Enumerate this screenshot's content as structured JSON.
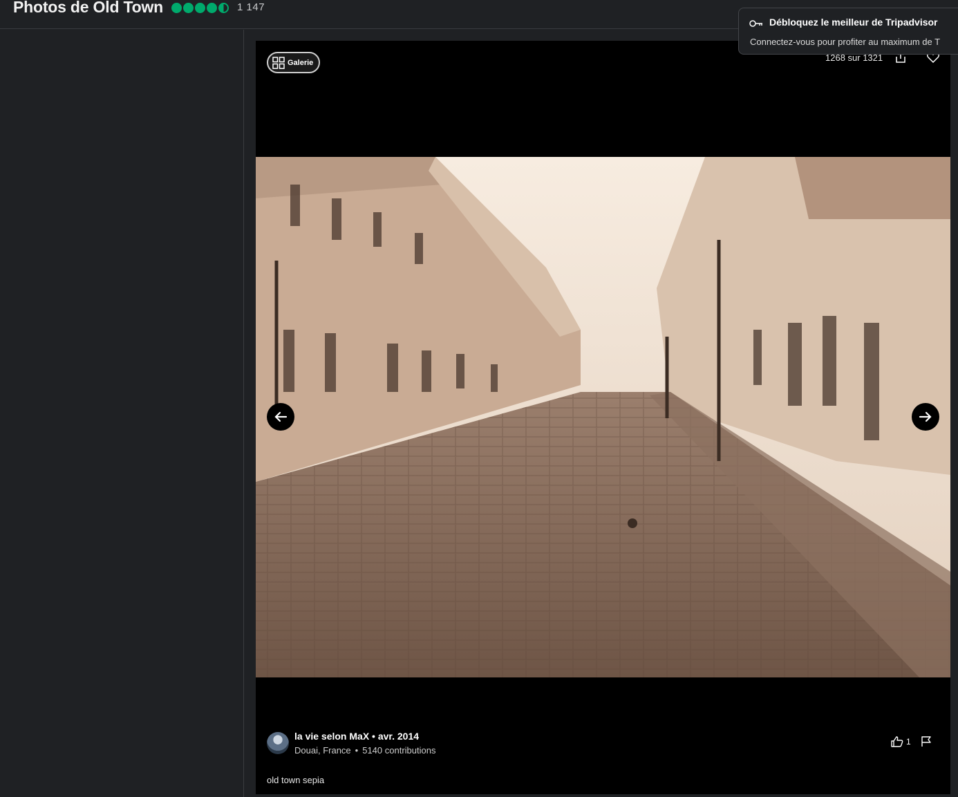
{
  "header": {
    "title": "Photos de Old Town",
    "rating_bubbles": 4.5,
    "review_count": "1 147"
  },
  "viewer": {
    "gallery_label": "Galerie",
    "counter": "1268 sur 1321",
    "prev_icon": "arrow-left-icon",
    "next_icon": "arrow-right-icon"
  },
  "author": {
    "name_date": "la vie selon MaX • avr. 2014",
    "location": "Douai, France",
    "contributions": "5140 contributions",
    "likes": "1"
  },
  "caption": "old town sepia",
  "toast": {
    "title": "Débloquez le meilleur de Tripadvisor",
    "body": "Connectez-vous pour profiter au maximum de T"
  },
  "colors": {
    "rating_green": "#00aa6c",
    "background": "#1f2124",
    "viewer_bg": "#000000"
  }
}
